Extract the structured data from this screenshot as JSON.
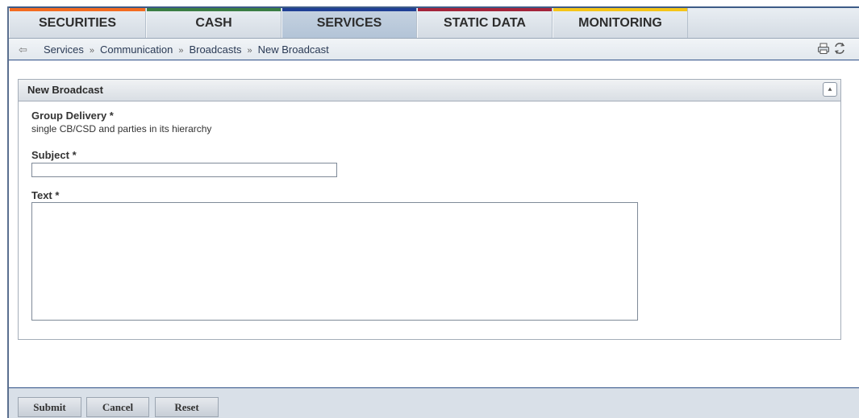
{
  "nav": {
    "tabs": [
      {
        "label": "SECURITIES",
        "accent": "#f36b21",
        "active": false
      },
      {
        "label": "CASH",
        "accent": "#3a7d44",
        "active": false
      },
      {
        "label": "SERVICES",
        "accent": "#1f3f95",
        "active": true
      },
      {
        "label": "STATIC DATA",
        "accent": "#a3243b",
        "active": false
      },
      {
        "label": "MONITORING",
        "accent": "#f5c518",
        "active": false
      }
    ]
  },
  "breadcrumb": {
    "items": [
      "Services",
      "Communication",
      "Broadcasts",
      "New Broadcast"
    ],
    "separator": "»",
    "back_icon": "back-arrow-icon",
    "tools": [
      "print-icon",
      "refresh-icon"
    ]
  },
  "panel": {
    "title": "New Broadcast",
    "collapse_icon": "collapse-up-icon",
    "group_delivery": {
      "label": "Group Delivery *",
      "value": "single CB/CSD and parties in its hierarchy"
    },
    "subject": {
      "label": "Subject *",
      "value": ""
    },
    "text": {
      "label": "Text *",
      "value": ""
    }
  },
  "actions": {
    "submit": "Submit",
    "cancel": "Cancel",
    "reset": "Reset"
  }
}
